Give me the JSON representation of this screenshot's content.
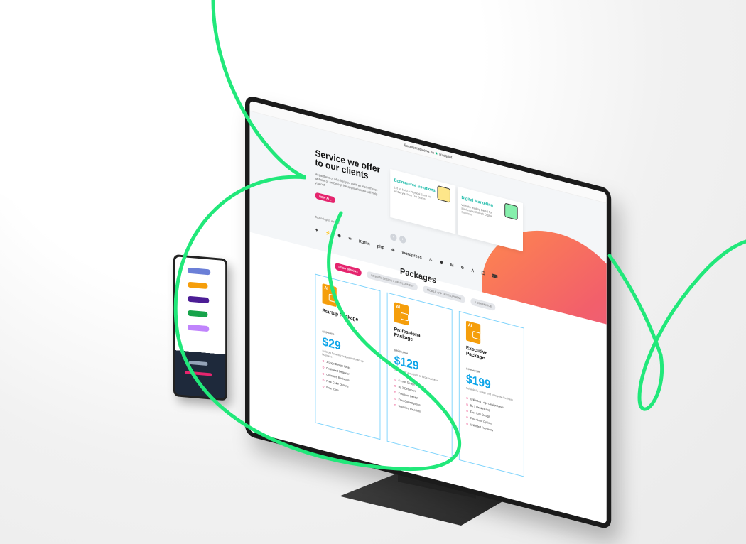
{
  "topbar": {
    "text": "Excellent reviews on",
    "brand": "Trustpilot"
  },
  "hero": {
    "title": "Service we offer to our clients",
    "description": "Regardless of whether you want an Ecommerce website or an Enterprise application we will help you out.",
    "cta": "VIEW ALL",
    "tech_label": "Technologies we use",
    "tech_logos": [
      "✦",
      "⚡",
      "✺",
      "⚛",
      "Kotlin",
      "php",
      "⊛",
      "wordpress",
      "♨",
      "⬢",
      "M",
      "↻",
      "A",
      "☷",
      "⌨"
    ]
  },
  "services": [
    {
      "title": "Ecommerce Solutions",
      "description": "Let us build a Physical Store for all the you from Our Stores"
    },
    {
      "title": "Digital Marketing",
      "description": "With the leading Digital for Market you through Digital Solutions"
    }
  ],
  "carousel": {
    "prev": "‹",
    "next": "›"
  },
  "packages": {
    "title": "Packages",
    "tabs": [
      "LOGO DESIGNS",
      "WEBSITE DESIGN & DEVELOPMENT",
      "MOBILE APP DEVELOPMENT",
      "E-COMMERCE"
    ],
    "active_tab": 0,
    "cards": [
      {
        "icon": "AI",
        "name": "Startup Package",
        "old_price": "$99 USD",
        "price": "$29",
        "note": "Suitable for a low budget and start-up business",
        "features": [
          "3 Logo Design Ideas",
          "Dedicated Designer",
          "Unlimited Revisions",
          "Free Color Options",
          "Free Icons"
        ]
      },
      {
        "icon": "AI",
        "name": "Professional Package",
        "old_price": "$399 USD",
        "price": "$129",
        "note": "Suitable for a medium or large business",
        "features": [
          "6 Logo Design Idea(s)",
          "By 3 Designers",
          "Free Icon Design",
          "Free Color Options",
          "Unlimited Revisions"
        ]
      },
      {
        "icon": "AI",
        "name": "Executive Package",
        "old_price": "$799 USD",
        "price": "$199",
        "note": "Suitable for a high end enterprise business",
        "features": [
          "Unlimited Logo Design Ideas",
          "By 5 Designer(s)",
          "Free Icon Design",
          "Free Color Options",
          "Unlimited Revisions"
        ]
      }
    ]
  },
  "colors": {
    "accent_green": "#21e87a",
    "brand_pink": "#e5256e",
    "price_blue": "#0ea5e9",
    "blob_orange": "#ff8a4c",
    "service_teal": "#14b8a6",
    "icon_orange": "#f59e0b"
  }
}
